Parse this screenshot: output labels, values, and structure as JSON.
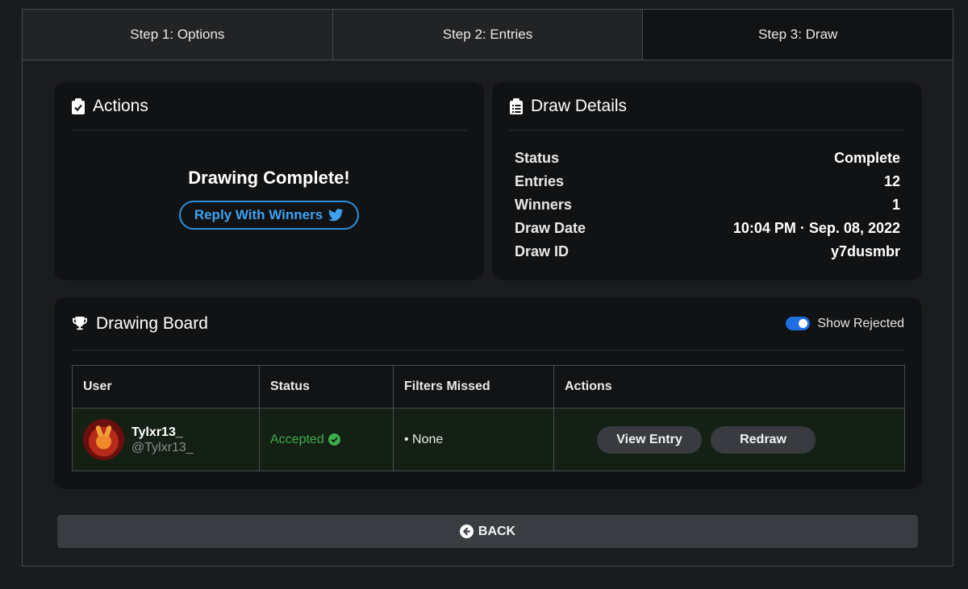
{
  "tabs": [
    {
      "label": "Step 1: Options"
    },
    {
      "label": "Step 2: Entries"
    },
    {
      "label": "Step 3: Draw"
    }
  ],
  "actions": {
    "title": "Actions",
    "complete_text": "Drawing Complete!",
    "reply_label": "Reply With Winners"
  },
  "details": {
    "title": "Draw Details",
    "rows": [
      {
        "label": "Status",
        "value": "Complete"
      },
      {
        "label": "Entries",
        "value": "12"
      },
      {
        "label": "Winners",
        "value": "1"
      },
      {
        "label": "Draw Date",
        "value": "10:04 PM · Sep. 08, 2022"
      },
      {
        "label": "Draw ID",
        "value": "y7dusmbr"
      }
    ]
  },
  "board": {
    "title": "Drawing Board",
    "show_rejected_label": "Show Rejected",
    "show_rejected": true,
    "columns": [
      "User",
      "Status",
      "Filters Missed",
      "Actions"
    ],
    "rows": [
      {
        "name": "Tylxr13_",
        "handle": "@Tylxr13_",
        "status": "Accepted",
        "filters_missed": "• None",
        "view_label": "View Entry",
        "redraw_label": "Redraw"
      }
    ]
  },
  "back_label": "BACK",
  "colors": {
    "accent_blue": "#2a8fe0",
    "accepted_green": "#3cae4a",
    "toggle_on": "#1f6fe0"
  }
}
